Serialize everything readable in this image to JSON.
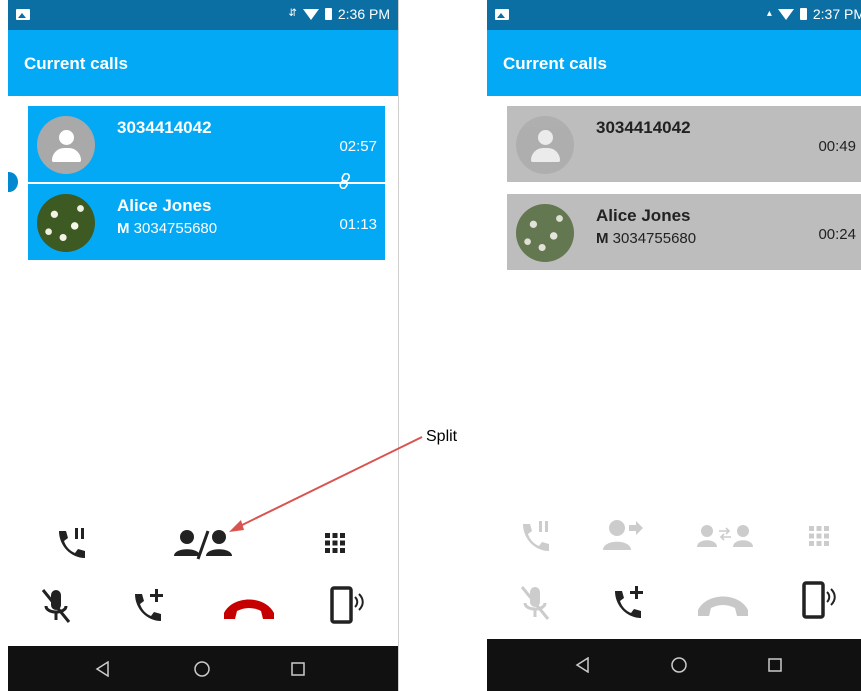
{
  "left_screen": {
    "status_time": "2:36 PM",
    "appbar_title": "Current calls",
    "calls": [
      {
        "name": "3034414042",
        "number_prefix": "",
        "number": "",
        "timer": "02:57",
        "avatar": "default"
      },
      {
        "name": "Alice Jones",
        "number_prefix": "M",
        "number": "3034755680",
        "timer": "01:13",
        "avatar": "photo"
      }
    ],
    "controls_row1": [
      "hold-icon",
      "split-icon",
      "dialpad-icon"
    ],
    "controls_row2": [
      "mute-icon",
      "add-call-icon",
      "end-call-icon",
      "speaker-icon"
    ]
  },
  "right_screen": {
    "status_time": "2:37 PM",
    "appbar_title": "Current calls",
    "calls": [
      {
        "name": "3034414042",
        "number_prefix": "",
        "number": "",
        "timer": "00:49",
        "avatar": "default"
      },
      {
        "name": "Alice Jones",
        "number_prefix": "M",
        "number": "3034755680",
        "timer": "00:24",
        "avatar": "photo"
      }
    ],
    "controls_row1": [
      "hold-icon",
      "transfer-icon",
      "swap-calls-icon",
      "dialpad-icon"
    ],
    "controls_row2": [
      "mute-icon",
      "add-call-icon",
      "end-call-icon",
      "speaker-icon"
    ]
  },
  "annotation": {
    "label": "Split"
  },
  "colors": {
    "status_bar": "#0b6fa3",
    "app_bar": "#03a9f4",
    "end_call": "#c60000",
    "annotation_arrow": "#d9534f",
    "inactive_card": "#bdbdbd"
  }
}
